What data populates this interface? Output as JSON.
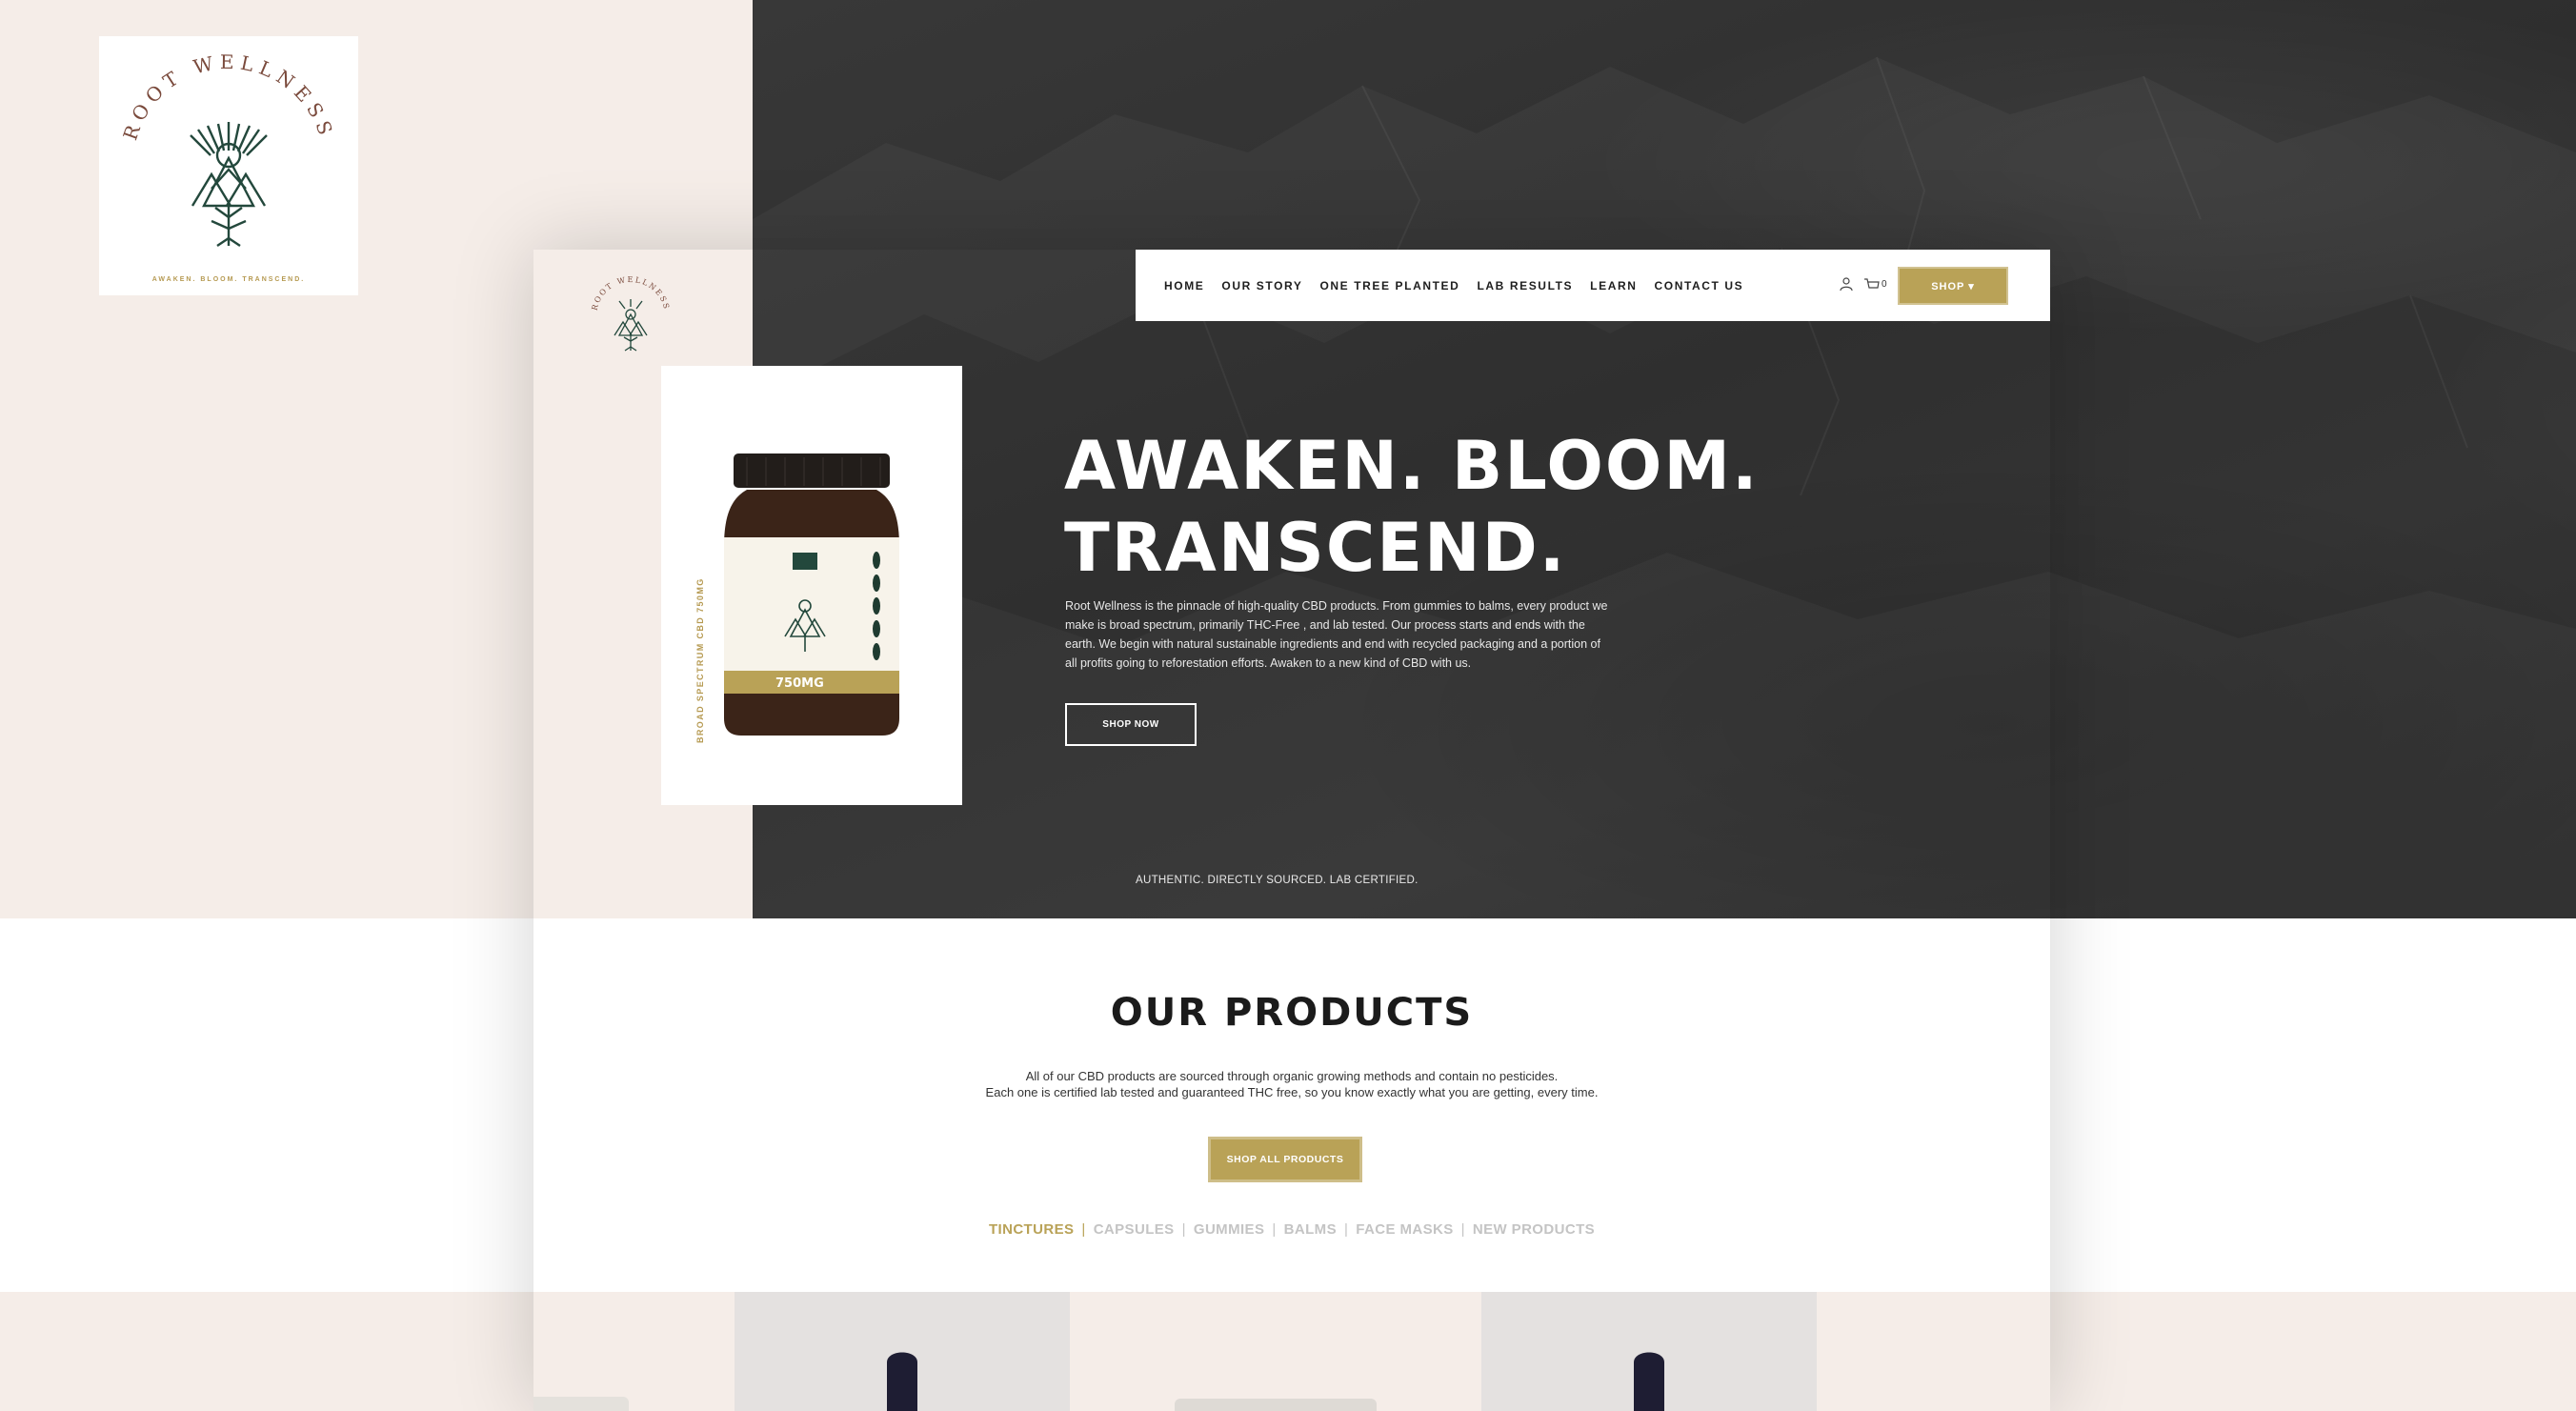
{
  "logo_card": {
    "brand": "ROOT WELLNESS",
    "tagline": "AWAKEN. BLOOM. TRANSCEND."
  },
  "nav": {
    "items": [
      "HOME",
      "OUR STORY",
      "ONE TREE PLANTED",
      "LAB RESULTS",
      "LEARN",
      "CONTACT US"
    ],
    "cart_count": "0",
    "shop_label": "SHOP ▾",
    "icons": [
      "user-icon",
      "cart-icon"
    ]
  },
  "product_card": {
    "side_text": "BROAD SPECTRUM CBD 750MG",
    "bottle_strength": "750MG"
  },
  "hero": {
    "title_line1": "AWAKEN. BLOOM.",
    "title_line2": "TRANSCEND.",
    "body": "Root Wellness is the pinnacle of high-quality CBD products. From gummies to balms, every product we make is broad spectrum, primarily THC-Free , and lab tested. Our process starts and ends with the earth. We begin with natural sustainable ingredients and end with recycled packaging and a portion of all profits going to reforestation efforts. Awaken to a new kind of CBD with us.",
    "button": "SHOP NOW",
    "footer_text": "AUTHENTIC. DIRECTLY SOURCED. LAB CERTIFIED."
  },
  "products": {
    "title": "OUR PRODUCTS",
    "line1": "All of our CBD products are sourced through organic growing methods and contain no pesticides.",
    "line2": "Each one is certified lab tested and guaranteed THC free, so you know exactly what you are getting, every time.",
    "button": "SHOP ALL PRODUCTS",
    "categories": [
      "TINCTURES",
      "CAPSULES",
      "GUMMIES",
      "BALMS",
      "FACE MASKS",
      "NEW PRODUCTS"
    ],
    "active_category": "TINCTURES"
  },
  "colors": {
    "gold": "#b9a257",
    "green": "#23483c",
    "brown": "#7a4a3c",
    "blush": "#f5ede8",
    "dark": "#303030"
  }
}
